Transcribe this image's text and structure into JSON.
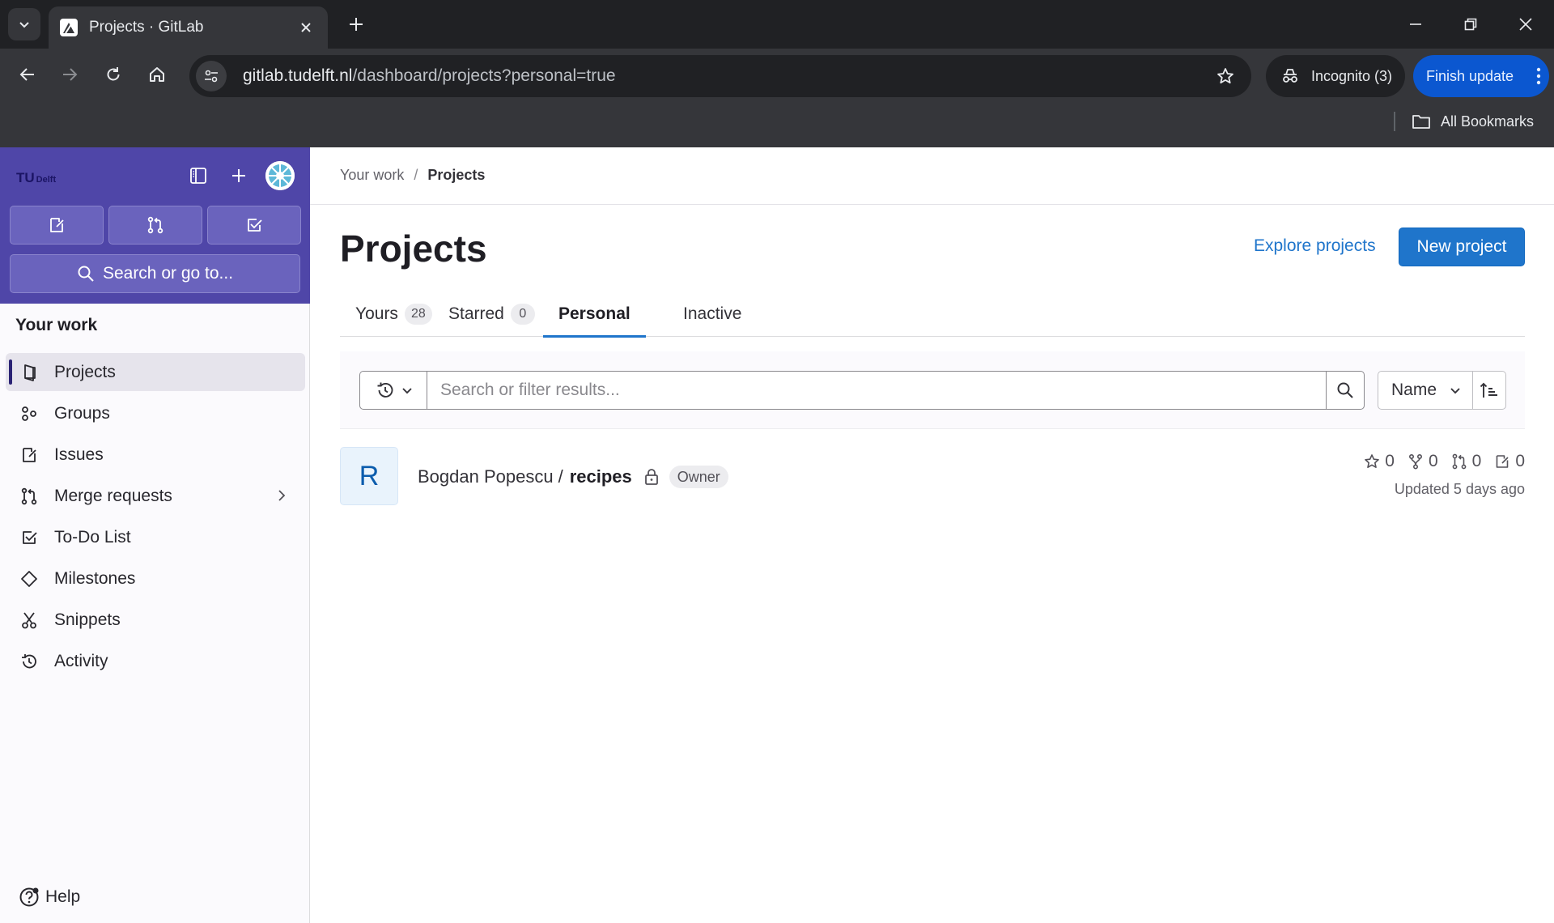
{
  "browser": {
    "tab_title": "Projects · GitLab",
    "url_host": "gitlab.tudelft.nl",
    "url_path": "/dashboard/projects?personal=true",
    "incognito_label": "Incognito (3)",
    "finish_update_label": "Finish update",
    "all_bookmarks_label": "All Bookmarks"
  },
  "sidebar": {
    "logo_big": "TU",
    "logo_small": "Delft",
    "search_label": "Search or go to...",
    "section_title": "Your work",
    "items": [
      {
        "label": "Projects",
        "icon": "project-icon"
      },
      {
        "label": "Groups",
        "icon": "group-icon"
      },
      {
        "label": "Issues",
        "icon": "issues-icon"
      },
      {
        "label": "Merge requests",
        "icon": "merge-request-icon"
      },
      {
        "label": "To-Do List",
        "icon": "todo-icon"
      },
      {
        "label": "Milestones",
        "icon": "milestone-icon"
      },
      {
        "label": "Snippets",
        "icon": "snippet-icon"
      },
      {
        "label": "Activity",
        "icon": "history-icon"
      }
    ],
    "help_label": "Help"
  },
  "breadcrumb": {
    "parent": "Your work",
    "separator": "/",
    "current": "Projects"
  },
  "page": {
    "title": "Projects",
    "explore_label": "Explore projects",
    "new_project_label": "New project"
  },
  "tabs": [
    {
      "label": "Yours",
      "count": "28"
    },
    {
      "label": "Starred",
      "count": "0"
    },
    {
      "label": "Personal",
      "count": null
    },
    {
      "label": "Inactive",
      "count": null
    }
  ],
  "filter": {
    "placeholder": "Search or filter results...",
    "sort_label": "Name"
  },
  "project": {
    "avatar_letter": "R",
    "namespace": "Bogdan Popescu",
    "separator": "/",
    "name": "recipes",
    "role": "Owner",
    "stars": "0",
    "forks": "0",
    "merge_requests": "0",
    "issues": "0",
    "updated": "Updated 5 days ago"
  },
  "colors": {
    "sidebar_brand": "#4f46a8",
    "primary_blue": "#1f75cb",
    "chrome_dark": "#202124",
    "chrome_toolbar": "#35363a",
    "update_button": "#0b57d0"
  }
}
